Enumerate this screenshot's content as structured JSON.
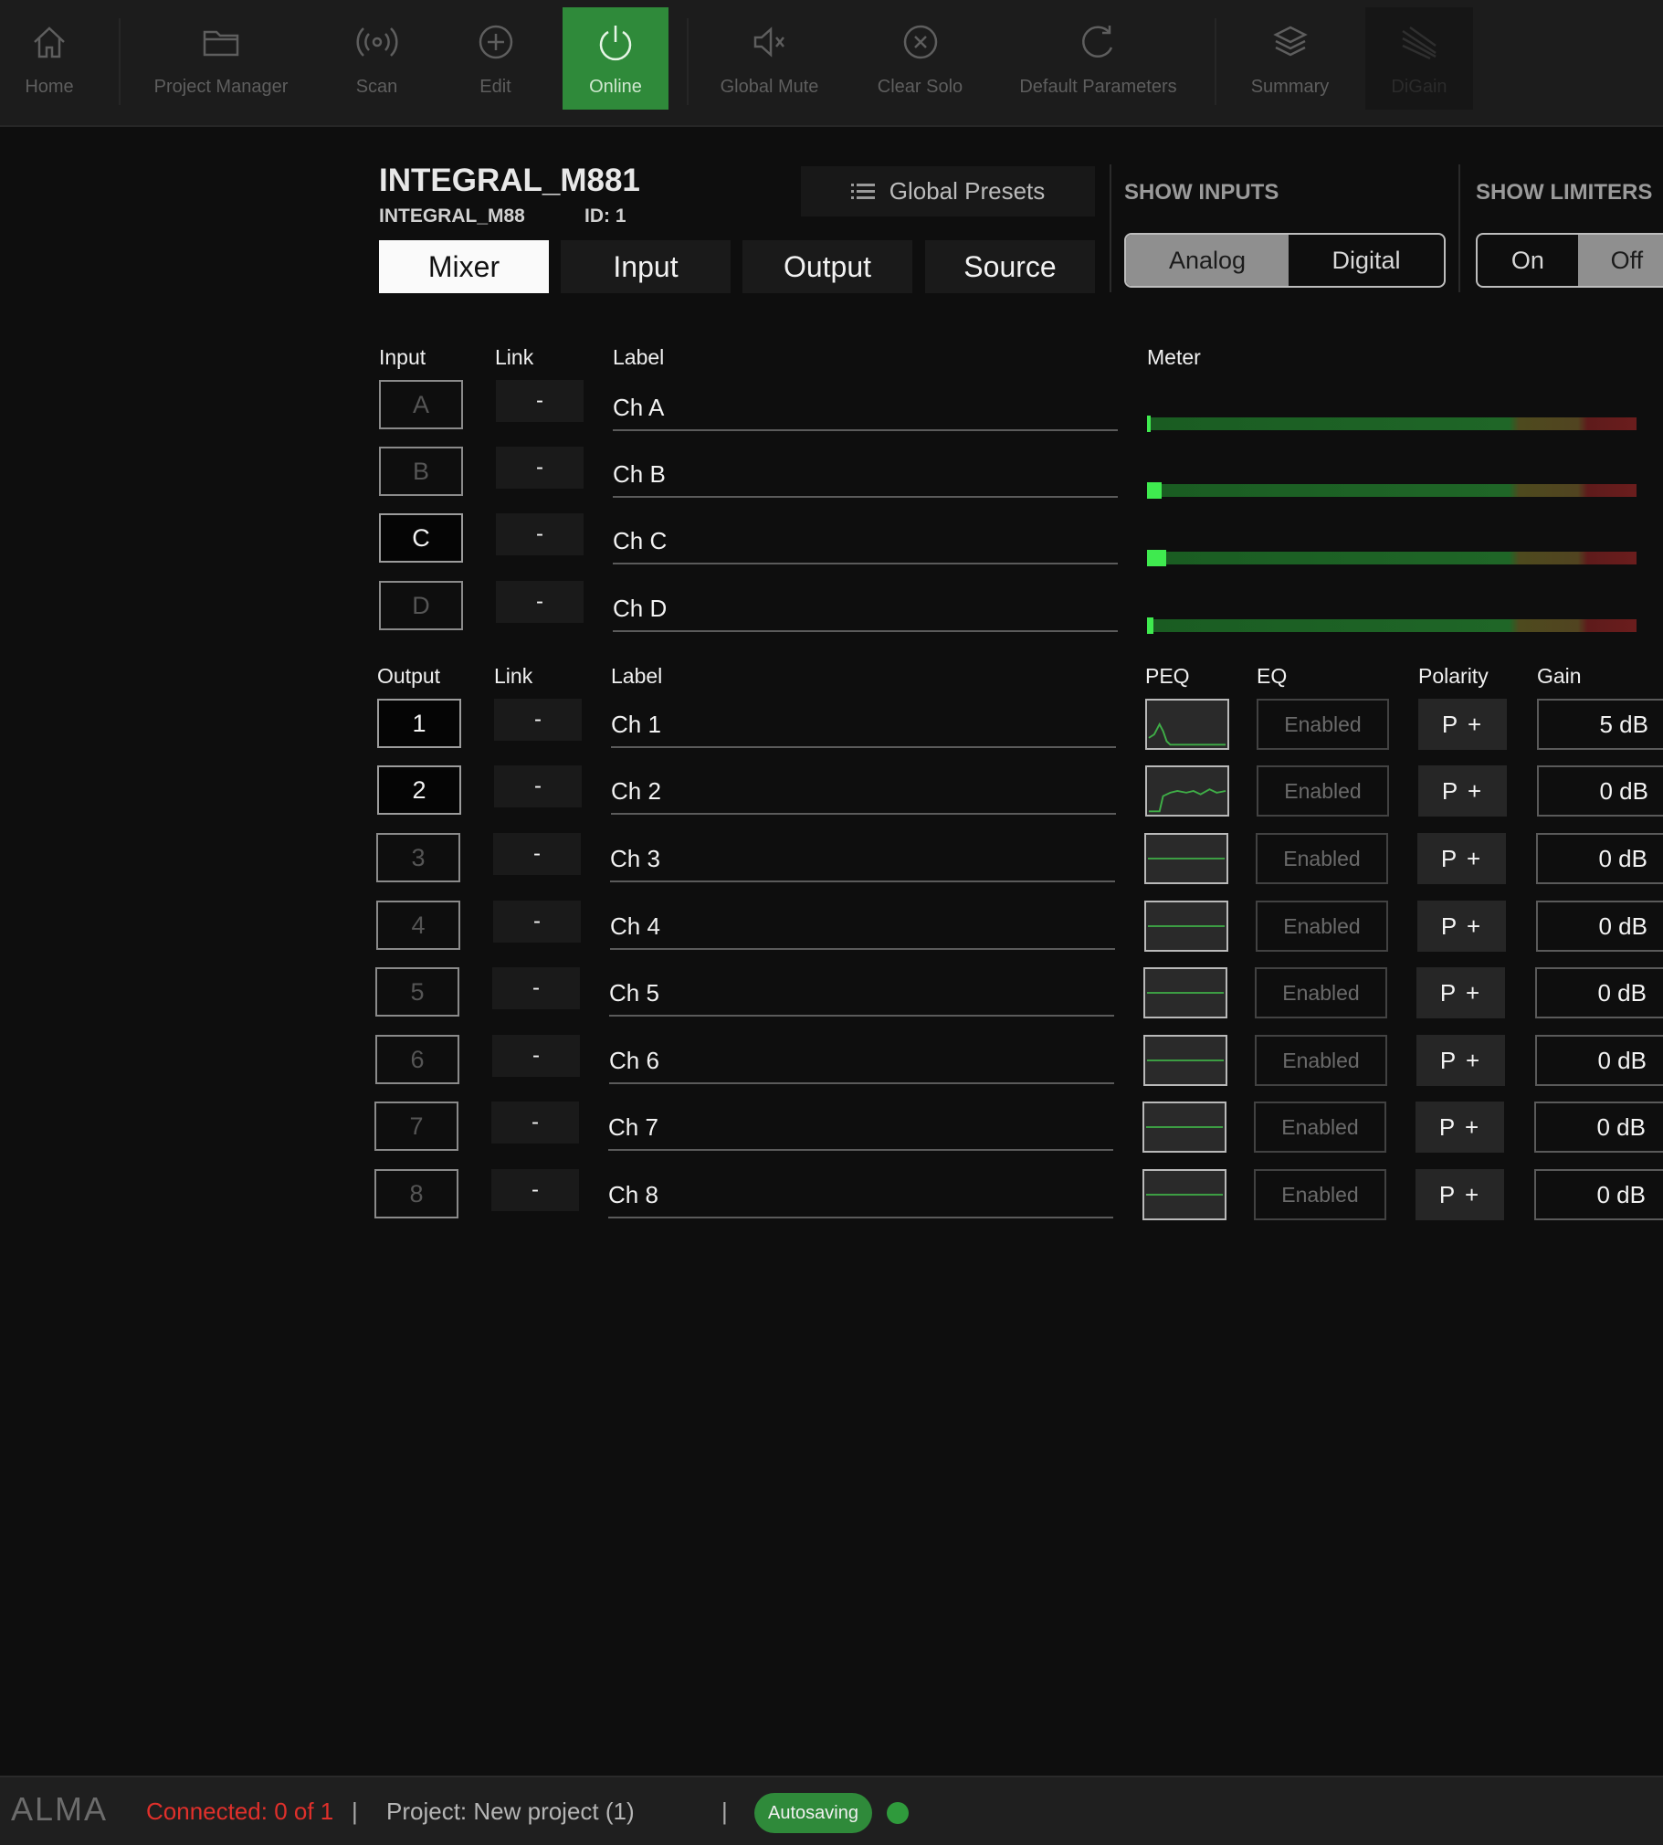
{
  "toolbar": {
    "buttons": [
      {
        "label": "Home",
        "icon": "home-icon"
      },
      {
        "label": "Project Manager",
        "icon": "folder-icon"
      },
      {
        "label": "Scan",
        "icon": "scan-icon"
      },
      {
        "label": "Edit",
        "icon": "plus-circle-icon"
      },
      {
        "label": "Online",
        "icon": "power-icon",
        "active": true
      },
      {
        "label": "Global Mute",
        "icon": "mute-icon"
      },
      {
        "label": "Clear Solo",
        "icon": "clear-circle-icon"
      },
      {
        "label": "Default Parameters",
        "icon": "reset-icon"
      },
      {
        "label": "Summary",
        "icon": "layers-icon"
      },
      {
        "label": "DiGain",
        "icon": "digain-icon",
        "dim": true
      }
    ]
  },
  "device": {
    "name": "INTEGRAL_M881",
    "model": "INTEGRAL_M88",
    "id": "ID: 1"
  },
  "tabs": [
    {
      "label": "Mixer",
      "active": true
    },
    {
      "label": "Input"
    },
    {
      "label": "Output"
    },
    {
      "label": "Source"
    }
  ],
  "global_presets": {
    "label": "Global Presets",
    "icon": "list-icon"
  },
  "show_inputs": {
    "title": "SHOW INPUTS",
    "options": [
      "Analog",
      "Digital"
    ],
    "selected": "Analog"
  },
  "show_limiters": {
    "title": "SHOW LIMITERS",
    "options": [
      "On",
      "Off"
    ],
    "selected": "Off"
  },
  "inputs": {
    "headers": {
      "input": "Input",
      "link": "Link",
      "label": "Label",
      "meter": "Meter"
    },
    "rows": [
      {
        "id": "A",
        "link": "-",
        "label": "Ch A",
        "meter": 0.006,
        "selected": false
      },
      {
        "id": "B",
        "link": "-",
        "label": "Ch B",
        "meter": 0.03,
        "selected": false
      },
      {
        "id": "C",
        "link": "-",
        "label": "Ch C",
        "meter": 0.04,
        "selected": true
      },
      {
        "id": "D",
        "link": "-",
        "label": "Ch D",
        "meter": 0.013,
        "selected": false
      }
    ]
  },
  "outputs": {
    "headers": {
      "output": "Output",
      "link": "Link",
      "label": "Label",
      "peq": "PEQ",
      "eq": "EQ",
      "polarity": "Polarity",
      "gain": "Gain"
    },
    "rows": [
      {
        "id": "1",
        "link": "-",
        "label": "Ch 1",
        "eq": "Enabled",
        "polarity": "P +",
        "gain": "5 dB",
        "selected": true,
        "peq_curve": "peak"
      },
      {
        "id": "2",
        "link": "-",
        "label": "Ch 2",
        "eq": "Enabled",
        "polarity": "P +",
        "gain": "0 dB",
        "selected": true,
        "peq_curve": "shelf"
      },
      {
        "id": "3",
        "link": "-",
        "label": "Ch 3",
        "eq": "Enabled",
        "polarity": "P +",
        "gain": "0 dB",
        "selected": false,
        "peq_curve": "flat"
      },
      {
        "id": "4",
        "link": "-",
        "label": "Ch 4",
        "eq": "Enabled",
        "polarity": "P +",
        "gain": "0 dB",
        "selected": false,
        "peq_curve": "flat"
      },
      {
        "id": "5",
        "link": "-",
        "label": "Ch 5",
        "eq": "Enabled",
        "polarity": "P +",
        "gain": "0 dB",
        "selected": false,
        "peq_curve": "flat"
      },
      {
        "id": "6",
        "link": "-",
        "label": "Ch 6",
        "eq": "Enabled",
        "polarity": "P +",
        "gain": "0 dB",
        "selected": false,
        "peq_curve": "flat"
      },
      {
        "id": "7",
        "link": "-",
        "label": "Ch 7",
        "eq": "Enabled",
        "polarity": "P +",
        "gain": "0 dB",
        "selected": false,
        "peq_curve": "flat"
      },
      {
        "id": "8",
        "link": "-",
        "label": "Ch 8",
        "eq": "Enabled",
        "polarity": "P +",
        "gain": "0 dB",
        "selected": false,
        "peq_curve": "flat"
      }
    ]
  },
  "statusbar": {
    "brand": "ALMA",
    "connected": "Connected: 0 of 1",
    "separator": "|",
    "project": "Project: New project (1)",
    "autosave": "Autosaving",
    "colors": {
      "connected": "#e0302b",
      "autosave": "#2f8a3a"
    }
  }
}
